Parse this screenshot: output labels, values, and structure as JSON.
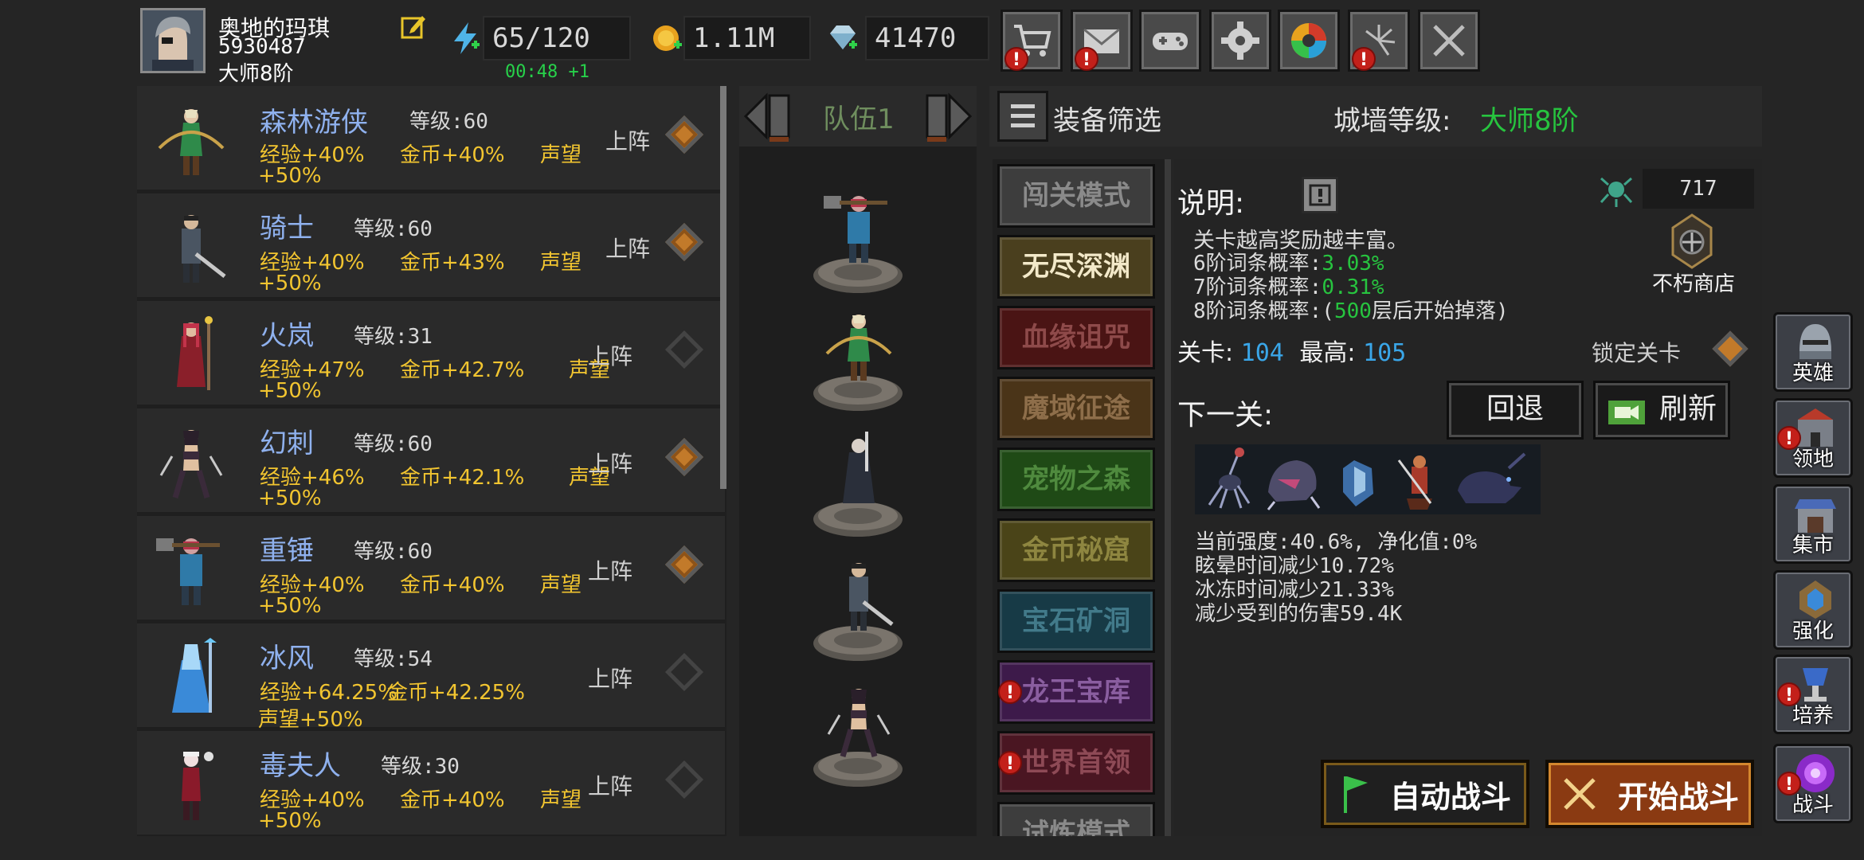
{
  "player": {
    "name": "奥地的玛琪",
    "id": "5930487",
    "rank": "大师8阶"
  },
  "resources": {
    "energy": "65/120",
    "energy_timer": "00:48 +1",
    "gold": "1.11M",
    "gems": "41470"
  },
  "toolbar": {
    "icons": [
      "cart-icon",
      "mail-icon",
      "gamepad-icon",
      "gear-icon",
      "color-wheel-icon",
      "firework-icon",
      "crossed-swords-icon"
    ]
  },
  "heroes": [
    {
      "name": "森林游侠",
      "level": "等级:60",
      "exp": "经验+40%",
      "gold": "金币+40%",
      "fame": "声望",
      "fame_val": "+50%",
      "deploy": "上阵",
      "deployed": true
    },
    {
      "name": "骑士",
      "level": "等级:60",
      "exp": "经验+40%",
      "gold": "金币+43%",
      "fame": "声望",
      "fame_val": "+50%",
      "deploy": "上阵",
      "deployed": true
    },
    {
      "name": "火岚",
      "level": "等级:31",
      "exp": "经验+47%",
      "gold": "金币+42.7%",
      "fame": "声望",
      "fame_val": "+50%",
      "deploy": "上阵",
      "deployed": false
    },
    {
      "name": "幻刺",
      "level": "等级:60",
      "exp": "经验+46%",
      "gold": "金币+42.1%",
      "fame": "声望",
      "fame_val": "+50%",
      "deploy": "上阵",
      "deployed": true
    },
    {
      "name": "重锤",
      "level": "等级:60",
      "exp": "经验+40%",
      "gold": "金币+40%",
      "fame": "声望",
      "fame_val": "+50%",
      "deploy": "上阵",
      "deployed": true
    },
    {
      "name": "冰风",
      "level": "等级:54",
      "exp": "经验+64.25%",
      "gold": "金币+42.25%",
      "fame": "声望+50%",
      "fame_val": "",
      "deploy": "上阵",
      "deployed": false
    },
    {
      "name": "毒夫人",
      "level": "等级:30",
      "exp": "经验+40%",
      "gold": "金币+40%",
      "fame": "声望",
      "fame_val": "+50%",
      "deploy": "上阵",
      "deployed": false
    }
  ],
  "team": {
    "title": "队伍1"
  },
  "filter": {
    "label": "装备筛选",
    "wall_label": "城墙等级:",
    "wall_value": "大师8阶"
  },
  "modes": [
    {
      "label": "闯关模式",
      "color": "#3d3d3d",
      "text": "#8a8a8a",
      "alert": false
    },
    {
      "label": "无尽深渊",
      "color": "#4a3f1e",
      "text": "#f3e9c9",
      "alert": false
    },
    {
      "label": "血缘诅咒",
      "color": "#4a1414",
      "text": "#8e4a4a",
      "alert": false
    },
    {
      "label": "魔域征途",
      "color": "#4a3418",
      "text": "#8e6e4a",
      "alert": false
    },
    {
      "label": "宠物之森",
      "color": "#1f4a16",
      "text": "#4f8a3e",
      "alert": false
    },
    {
      "label": "金币秘窟",
      "color": "#4a4418",
      "text": "#8e8640",
      "alert": false
    },
    {
      "label": "宝石矿洞",
      "color": "#173a46",
      "text": "#427a8a",
      "alert": false
    },
    {
      "label": "龙王宝库",
      "color": "#3d1a4a",
      "text": "#8a5ea0",
      "alert": true
    },
    {
      "label": "世界首领",
      "color": "#4a1622",
      "text": "#8e4a56",
      "alert": true
    },
    {
      "label": "试炼模式",
      "color": "#3d3d3d",
      "text": "#8a8a8a",
      "alert": false
    }
  ],
  "info": {
    "title": "说明:",
    "currency": "717",
    "shop_label": "不朽商店",
    "desc": "关卡越高奖励越丰富。",
    "tier6_label": "6阶词条概率:",
    "tier6_value": "3.03%",
    "tier7_label": "7阶词条概率:",
    "tier7_value": "0.31%",
    "tier8_label": "8阶词条概率:(",
    "tier8_num": "500",
    "tier8_tail": "层后开始掉落)",
    "stage_label": "关卡:",
    "stage_value": "104",
    "best_label": "最高:",
    "best_value": "105",
    "lock_label": "锁定关卡",
    "next_label": "下一关:",
    "back_btn": "回退",
    "refresh_btn": "刷新",
    "strength": "当前强度:40.6%, 净化值:0%",
    "stun": "眩晕时间减少10.72%",
    "freeze": "冰冻时间减少21.33%",
    "damage": "减少受到的伤害59.4K",
    "auto_btn": "自动战斗",
    "start_btn": "开始战斗"
  },
  "sidenav": [
    {
      "label": "英雄",
      "alert": false
    },
    {
      "label": "领地",
      "alert": true
    },
    {
      "label": "集市",
      "alert": false
    },
    {
      "label": "强化",
      "alert": false
    },
    {
      "label": "培养",
      "alert": true
    },
    {
      "label": "战斗",
      "alert": true
    }
  ]
}
